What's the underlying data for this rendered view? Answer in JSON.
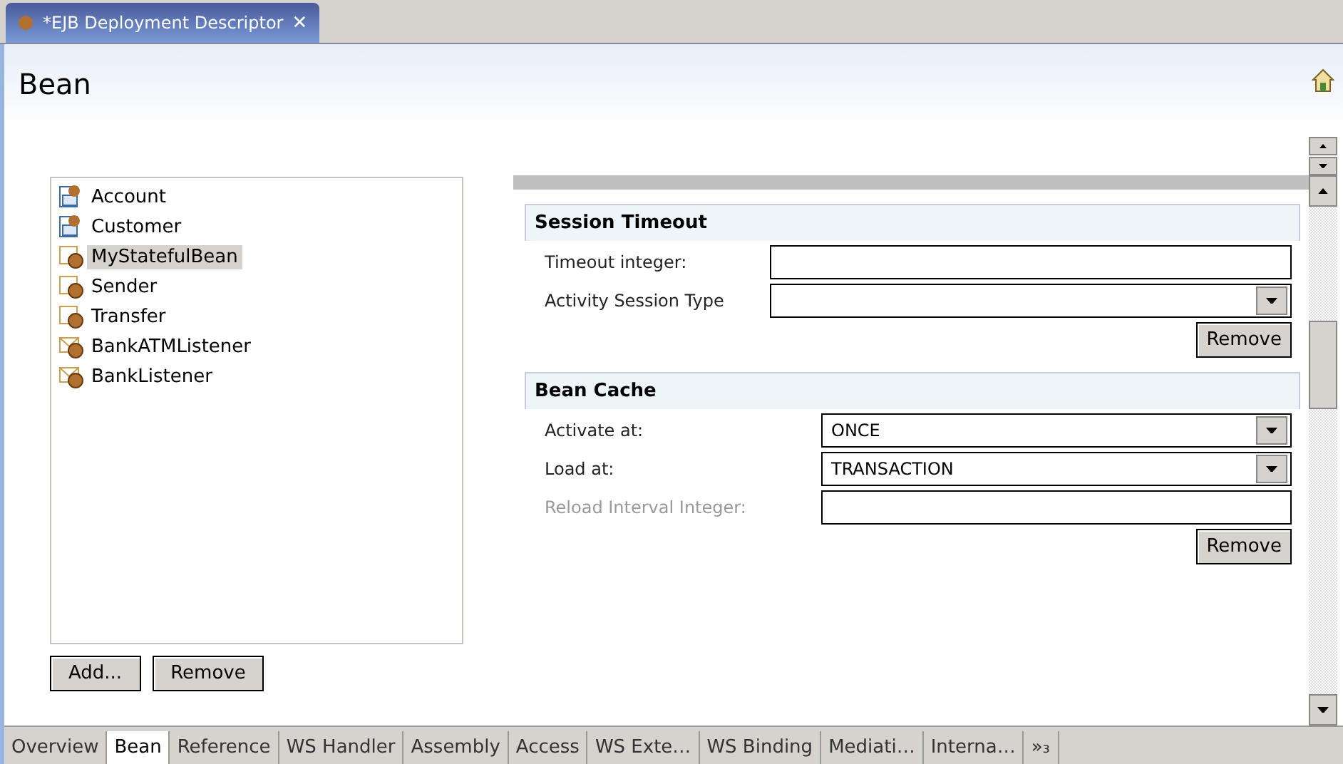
{
  "editor_tab": {
    "title": "*EJB Deployment Descriptor",
    "close": "✕"
  },
  "page_title": "Bean",
  "beans": [
    {
      "name": "Account",
      "kind": "entity",
      "selected": false
    },
    {
      "name": "Customer",
      "kind": "entity",
      "selected": false
    },
    {
      "name": "MyStatefulBean",
      "kind": "session",
      "selected": true
    },
    {
      "name": "Sender",
      "kind": "session",
      "selected": false
    },
    {
      "name": "Transfer",
      "kind": "session",
      "selected": false
    },
    {
      "name": "BankATMListener",
      "kind": "message",
      "selected": false
    },
    {
      "name": "BankListener",
      "kind": "message",
      "selected": false
    }
  ],
  "list_buttons": [
    "Add...",
    "Remove"
  ],
  "sections": [
    {
      "title": "Session Timeout",
      "fields": [
        {
          "label": "Timeout integer:",
          "kind": "text",
          "disabled": false
        },
        {
          "label": "Activity Session Type",
          "kind": "select",
          "disabled": false
        }
      ],
      "button": "Remove"
    },
    {
      "title": "Bean Cache",
      "fields": [
        {
          "label": "Activate at:",
          "kind": "select",
          "value": "ONCE",
          "disabled": false
        },
        {
          "label": "Load at:",
          "kind": "select",
          "value": "TRANSACTION",
          "disabled": false
        },
        {
          "label": "Reload Interval Integer:",
          "kind": "text",
          "disabled": true
        }
      ],
      "button": "Remove"
    }
  ],
  "bottom_tabs": [
    {
      "label": "Overview",
      "selected": false
    },
    {
      "label": "Bean",
      "selected": true
    },
    {
      "label": "Reference",
      "selected": false
    },
    {
      "label": "WS Handler",
      "selected": false
    },
    {
      "label": "Assembly",
      "selected": false
    },
    {
      "label": "Access",
      "selected": false
    },
    {
      "label": "WS Exte…",
      "selected": false
    },
    {
      "label": "WS Binding",
      "selected": false
    },
    {
      "label": "Mediati…",
      "selected": false
    },
    {
      "label": "Interna…",
      "selected": false
    }
  ],
  "more_tabs": "»₃"
}
